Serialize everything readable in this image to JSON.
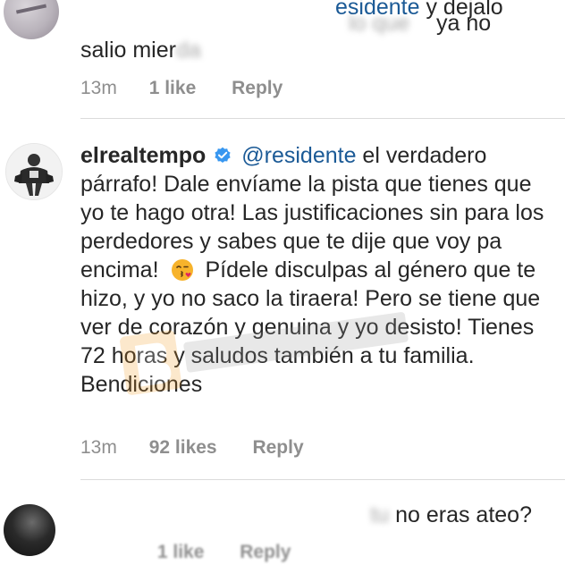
{
  "top_comment": {
    "mention_fragment": "esidente",
    "line1_after": " y dejalo",
    "line1_end": "ya no",
    "line2_visible": "salio mier",
    "time": "13m",
    "likes": "1 like",
    "reply": "Reply"
  },
  "main_comment": {
    "username": "elrealtempo",
    "mention": "@residente",
    "text_part1": " el verdadero párrafo! Dale envíame la pista que tienes que yo te hago otra! Las justificaciones sin para los perdedores y sabes que te dije que voy pa encima!",
    "emoji_name": "kissing-face-icon",
    "text_part2": "Pídele disculpas al género que te hizo, y yo no saco la tiraera! Pero se tiene que ver de corazón y genuina y yo desisto! Tienes 72 horas y saludos también a tu familia. Bendiciones",
    "time": "13m",
    "likes": "92 likes",
    "reply": "Reply"
  },
  "bottom_comment": {
    "blurred_lead": "tu",
    "text_visible": "no eras ateo?",
    "time": "",
    "likes": "1 like",
    "reply": "Reply"
  },
  "colors": {
    "text": "#262626",
    "meta": "#8e8e8e",
    "mention": "#1b5a96",
    "verified": "#3897f0",
    "divider": "#dbdbdb"
  }
}
